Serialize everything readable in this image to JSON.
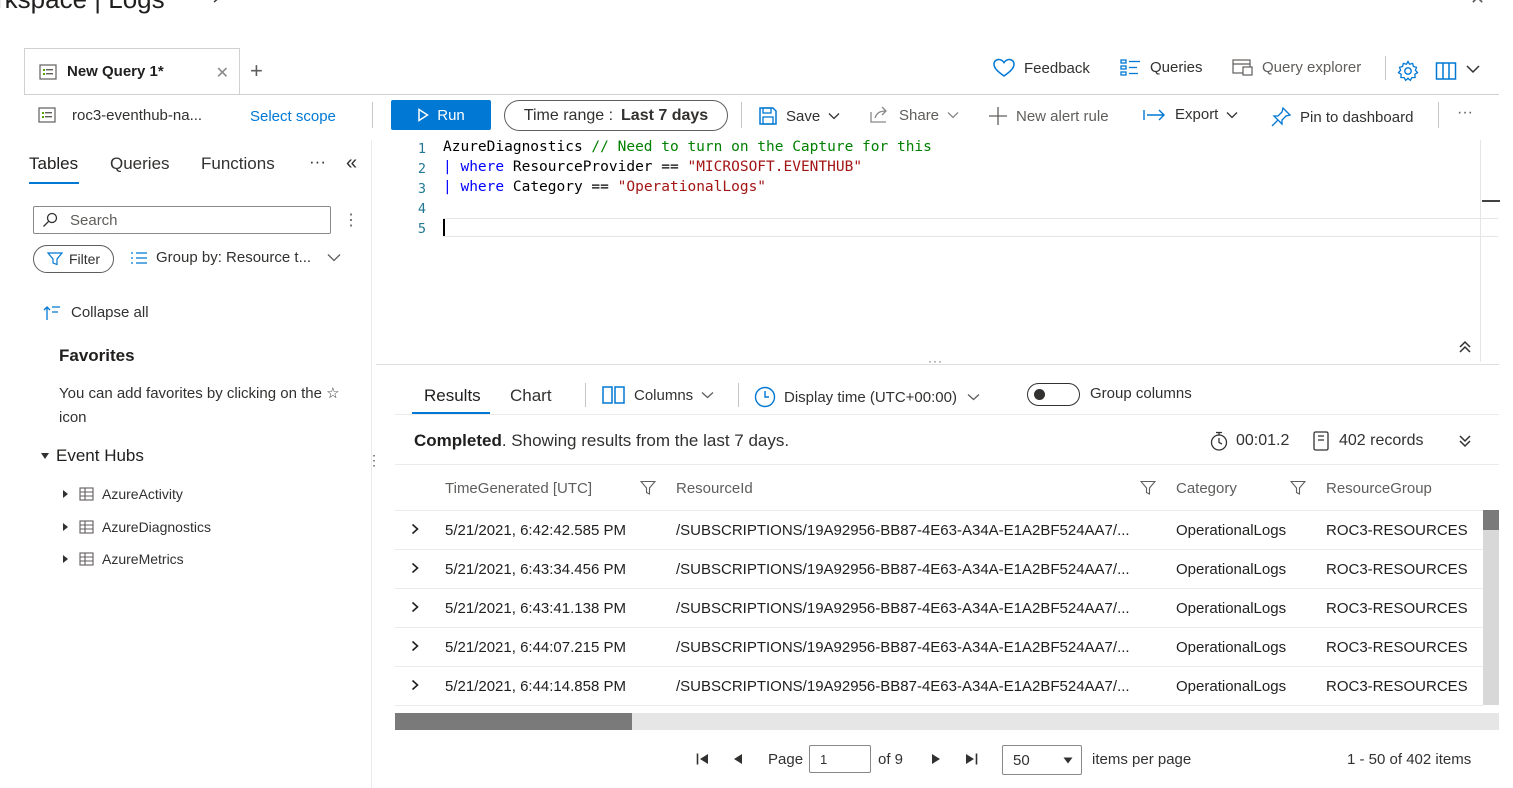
{
  "header": {
    "title": "rkspace | Logs",
    "close_symbol": "✕"
  },
  "tabs": {
    "active_label": "New Query 1*",
    "close_symbol": "✕",
    "add_symbol": "+"
  },
  "top_actions": {
    "feedback": "Feedback",
    "queries": "Queries",
    "query_explorer": "Query explorer"
  },
  "toolbar": {
    "scope_name": "roc3-eventhub-na...",
    "select_scope": "Select scope",
    "run": "Run",
    "time_range_label": "Time range :",
    "time_range_value": "Last 7 days",
    "save": "Save",
    "share": "Share",
    "new_alert_rule": "New alert rule",
    "export": "Export",
    "pin_to_dashboard": "Pin to dashboard",
    "more": "···"
  },
  "sidebar": {
    "tabs": [
      "Tables",
      "Queries",
      "Functions"
    ],
    "more": "···",
    "collapse": "«",
    "search_placeholder": "Search",
    "search_more": "⋮",
    "filter": "Filter",
    "group_by": "Group by: Resource t...",
    "collapse_all": "Collapse all",
    "favorites_title": "Favorites",
    "favorites_text": "You can add favorites by clicking on the ☆ icon",
    "group_name": "Event Hubs",
    "tables": [
      "AzureActivity",
      "AzureDiagnostics",
      "AzureMetrics"
    ],
    "resize_handle": "⋮"
  },
  "editor": {
    "line_numbers": [
      "1",
      "2",
      "3",
      "4",
      "5"
    ],
    "line1_table": "AzureDiagnostics",
    "line1_comment": "// Need to turn on the Capture for this",
    "line2_pipe": "|",
    "line2_kw": "where",
    "line2_field": "ResourceProvider ==",
    "line2_value": "\"MICROSOFT.EVENTHUB\"",
    "line3_pipe": "|",
    "line3_kw": "where",
    "line3_field": "Category ==",
    "line3_value": "\"OperationalLogs\""
  },
  "results": {
    "splitter_dots": "···",
    "tabs": [
      "Results",
      "Chart"
    ],
    "columns_label": "Columns",
    "display_time": "Display time (UTC+00:00)",
    "group_columns": "Group columns",
    "group_columns_on": false,
    "status_bold": "Completed",
    "status_rest": ". Showing results from the last 7 days.",
    "elapsed": "00:01.2",
    "records": "402 records",
    "columns": [
      "TimeGenerated [UTC]",
      "ResourceId",
      "Category",
      "ResourceGroup"
    ],
    "rows": [
      {
        "time": "5/21/2021, 6:42:42.585 PM",
        "resource_id": "/SUBSCRIPTIONS/19A92956-BB87-4E63-A34A-E1A2BF524AA7/...",
        "category": "OperationalLogs",
        "resource_group": "ROC3-RESOURCES"
      },
      {
        "time": "5/21/2021, 6:43:34.456 PM",
        "resource_id": "/SUBSCRIPTIONS/19A92956-BB87-4E63-A34A-E1A2BF524AA7/...",
        "category": "OperationalLogs",
        "resource_group": "ROC3-RESOURCES"
      },
      {
        "time": "5/21/2021, 6:43:41.138 PM",
        "resource_id": "/SUBSCRIPTIONS/19A92956-BB87-4E63-A34A-E1A2BF524AA7/...",
        "category": "OperationalLogs",
        "resource_group": "ROC3-RESOURCES"
      },
      {
        "time": "5/21/2021, 6:44:07.215 PM",
        "resource_id": "/SUBSCRIPTIONS/19A92956-BB87-4E63-A34A-E1A2BF524AA7/...",
        "category": "OperationalLogs",
        "resource_group": "ROC3-RESOURCES"
      },
      {
        "time": "5/21/2021, 6:44:14.858 PM",
        "resource_id": "/SUBSCRIPTIONS/19A92956-BB87-4E63-A34A-E1A2BF524AA7/...",
        "category": "OperationalLogs",
        "resource_group": "ROC3-RESOURCES"
      }
    ]
  },
  "pager": {
    "page_label": "Page",
    "page_value": "1",
    "of_pages": "of 9",
    "per_page_value": "50",
    "items_per_page": "items per page",
    "range": "1 - 50 of 402 items"
  },
  "colors": {
    "accent": "#0078d4",
    "keyword": "#0000ff",
    "comment": "#008000",
    "string": "#a31515",
    "line_number": "#237893"
  }
}
